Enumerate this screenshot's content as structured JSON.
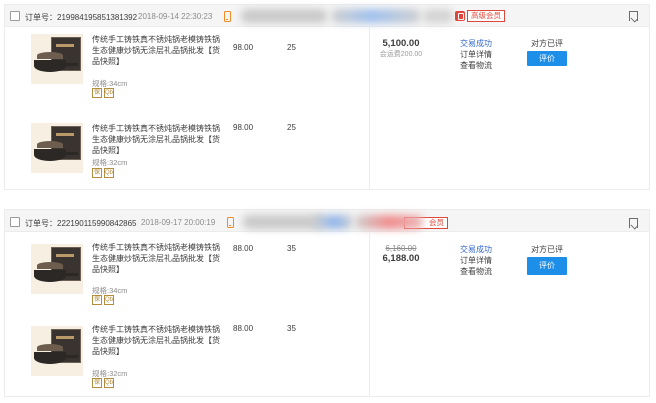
{
  "orders": [
    {
      "order_no": "订单号：219984195851381392",
      "date": "2018-09-14 22:30:23",
      "member_label": "高级会员",
      "items": [
        {
          "title": "传统手工铸铁真不锈炖锅老模铸铁锅生态健康炒锅无涂层礼品锅批发【货品快照】",
          "spec": "规格:34cm",
          "price": "98.00",
          "qty": "25",
          "icons": [
            "保",
            "Qb"
          ]
        },
        {
          "title": "传统手工铸铁真不锈炖锅老模铸铁锅生态健康炒锅无涂层礼品锅批发【货品快照】",
          "spec": "规格:32cm",
          "price": "98.00",
          "qty": "25",
          "icons": [
            "保",
            "Qb"
          ]
        }
      ],
      "original_total": "",
      "total": "5,100.00",
      "fee": "会运费200.00",
      "status": "交易成功",
      "detail_link": "订单详情",
      "logistics_link": "查看物流",
      "review_status": "对方已评",
      "review_button": "评价"
    },
    {
      "order_no": "订单号：222190115990842865",
      "date": "2018-09-17 20:00:19",
      "member_label": "会员",
      "items": [
        {
          "title": "传统手工铸铁真不锈炖锅老模铸铁锅生态健康炒锅无涂层礼品锅批发【货品快照】",
          "spec": "规格:34cm",
          "price": "88.00",
          "qty": "35",
          "icons": [
            "保",
            "Qb"
          ]
        },
        {
          "title": "传统手工铸铁真不锈炖锅老模铸铁锅生态健康炒锅无涂层礼品锅批发【货品快照】",
          "spec": "规格:32cm",
          "price": "88.00",
          "qty": "35",
          "icons": [
            "保",
            "Qb"
          ]
        }
      ],
      "original_total": "6,160.00",
      "total": "6,188.00",
      "fee": "",
      "status": "交易成功",
      "detail_link": "订单详情",
      "logistics_link": "查看物流",
      "review_status": "对方已评",
      "review_button": "评价"
    }
  ],
  "colors": {
    "accent_blue": "#1e8fe8",
    "link_blue": "#3366cc",
    "member_red": "#e0473b",
    "phone_orange": "#f08a24"
  },
  "icons": [
    "checkbox",
    "phone-icon",
    "member-badge-icon",
    "flag-icon",
    "guarantee-icon",
    "quality-icon"
  ]
}
